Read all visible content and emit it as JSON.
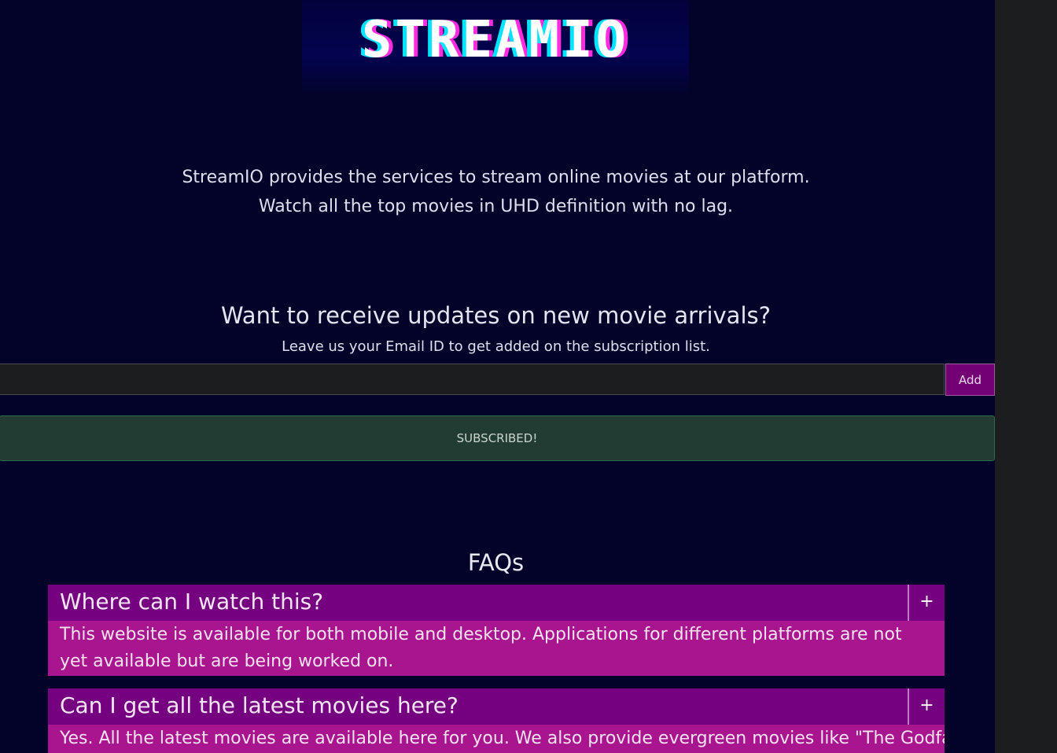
{
  "brand": {
    "logo_text": "STREAMIO"
  },
  "intro": {
    "line1": "StreamIO provides the services to stream online movies at our platform.",
    "line2": "Watch all the top movies in UHD definition with no lag."
  },
  "signup": {
    "heading": "Want to receive updates on new movie arrivals?",
    "subtext": "Leave us your Email ID to get added on the subscription list.",
    "email_value": "",
    "add_label": "Add",
    "status": "SUBSCRIBED!"
  },
  "faq": {
    "heading": "FAQs",
    "items": [
      {
        "question": "Where can I watch this?",
        "toggle": "+",
        "answer": "This website is available for both mobile and desktop. Applications for different platforms are not yet available but are being worked on."
      },
      {
        "question": "Can I get all the latest movies here?",
        "toggle": "+",
        "answer": "Yes. All the latest movies are available here for you. We also provide evergreen movies like \"The Godfather\"."
      }
    ]
  },
  "colors": {
    "page_background": "#03032a",
    "faq_question": "#760180",
    "faq_answer": "#a8158f",
    "add_button": "#740075",
    "status_background": "#233c33"
  }
}
